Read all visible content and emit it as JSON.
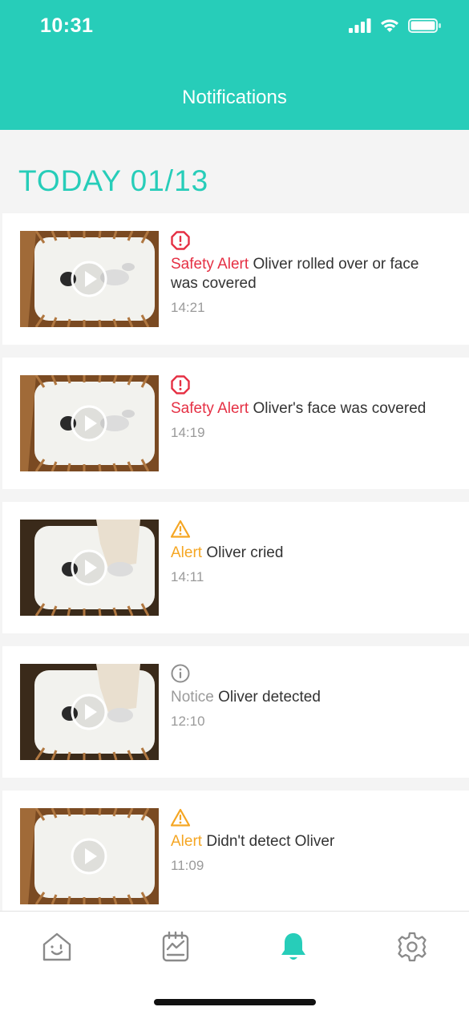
{
  "status_bar": {
    "time": "10:31"
  },
  "header": {
    "title": "Notifications"
  },
  "section": {
    "title": "TODAY 01/13"
  },
  "notifications": [
    {
      "level": "Safety Alert",
      "level_type": "safety",
      "message": "Oliver rolled over or face was covered",
      "time": "14:21"
    },
    {
      "level": "Safety Alert",
      "level_type": "safety",
      "message": "Oliver's face was covered",
      "time": "14:19"
    },
    {
      "level": "Alert",
      "level_type": "alert",
      "message": "Oliver cried",
      "time": "14:11"
    },
    {
      "level": "Notice",
      "level_type": "notice",
      "message": "Oliver detected",
      "time": "12:10"
    },
    {
      "level": "Alert",
      "level_type": "alert",
      "message": "Didn't detect Oliver",
      "time": "11:09"
    }
  ],
  "colors": {
    "brand": "#27cdb9",
    "safety": "#e53044",
    "alert": "#f5a623",
    "notice": "#9a9a9a"
  },
  "tabbar": {
    "items": [
      {
        "icon": "home-icon",
        "active": false
      },
      {
        "icon": "report-icon",
        "active": false
      },
      {
        "icon": "bell-icon",
        "active": true
      },
      {
        "icon": "gear-icon",
        "active": false
      }
    ]
  }
}
